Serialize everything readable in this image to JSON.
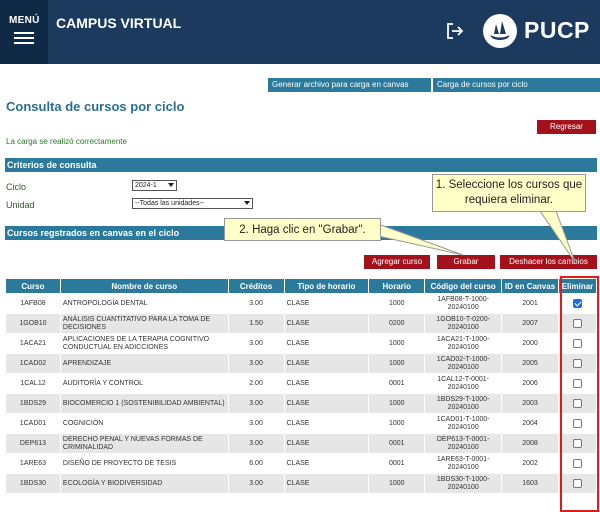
{
  "header": {
    "menu_label": "MENÚ",
    "app_title": "CAMPUS VIRTUAL",
    "brand": "PUCP"
  },
  "toplinks": {
    "generate": "Generar archivo para carga en canvas",
    "load": "Carga de cursos por ciclo"
  },
  "page": {
    "title": "Consulta de cursos por ciclo",
    "back_label": "Regresar",
    "success": "La carga se realizó correctamente"
  },
  "criteria": {
    "section_title": "Criterios de consulta",
    "ciclo_label": "Ciclo",
    "ciclo_value": "2024-1",
    "unidad_label": "Unidad",
    "unidad_value": "--Todas las unidades--"
  },
  "courses": {
    "section_title": "Cursos regstrados en canvas en el ciclo",
    "add_label": "Agregar curso",
    "save_label": "Grabar",
    "undo_label": "Deshacer los cambios",
    "columns": [
      "Curso",
      "Nombre de curso",
      "Créditos",
      "Tipo de horario",
      "Horario",
      "Código del curso",
      "ID en Canvas",
      "Eliminar"
    ],
    "rows": [
      {
        "curso": "1AFB08",
        "nombre": "ANTROPOLOGÍA DENTAL",
        "creditos": "3.00",
        "tipo": "CLASE",
        "horario": "1000",
        "codigo": "1AFB08-T-1000-20240100",
        "id": "2001",
        "eliminar": true
      },
      {
        "curso": "1GOB10",
        "nombre": "ANÁLISIS CUANTITATIVO PARA LA TOMA DE DECISIONES",
        "creditos": "1.50",
        "tipo": "CLASE",
        "horario": "0200",
        "codigo": "1GOB10-T-0200-20240100",
        "id": "2007",
        "eliminar": false
      },
      {
        "curso": "1ACA21",
        "nombre": "APLICACIONES DE LA TERAPIA COGNITIVO CONDUCTUAL EN ADICCIONES",
        "creditos": "3.00",
        "tipo": "CLASE",
        "horario": "1000",
        "codigo": "1ACA21-T-1000-20240100",
        "id": "2000",
        "eliminar": false
      },
      {
        "curso": "1CAD02",
        "nombre": "APRENDIZAJE",
        "creditos": "3.00",
        "tipo": "CLASE",
        "horario": "1000",
        "codigo": "1CAD02-T-1000-20240100",
        "id": "2005",
        "eliminar": false
      },
      {
        "curso": "1CAL12",
        "nombre": "AUDITORÍA Y CONTROL",
        "creditos": "2.00",
        "tipo": "CLASE",
        "horario": "0001",
        "codigo": "1CAL12-T-0001-20240100",
        "id": "2006",
        "eliminar": false
      },
      {
        "curso": "1BDS29",
        "nombre": "BIOCOMERCIO 1 (SOSTENIBILIDAD AMBIENTAL)",
        "creditos": "3.00",
        "tipo": "CLASE",
        "horario": "1000",
        "codigo": "1BDS29-T-1000-20240100",
        "id": "2003",
        "eliminar": false
      },
      {
        "curso": "1CAD01",
        "nombre": "COGNICIÓN",
        "creditos": "3.00",
        "tipo": "CLASE",
        "horario": "1000",
        "codigo": "1CAD01-T-1000-20240100",
        "id": "2004",
        "eliminar": false
      },
      {
        "curso": "DEP613",
        "nombre": "DERECHO PENAL Y NUEVAS FORMAS DE CRIMINALIDAD",
        "creditos": "3.00",
        "tipo": "CLASE",
        "horario": "0001",
        "codigo": "DEP613-T-0001-20240100",
        "id": "2008",
        "eliminar": false
      },
      {
        "curso": "1ARE63",
        "nombre": "DISEÑO DE PROYECTO DE TESIS",
        "creditos": "6.00",
        "tipo": "CLASE",
        "horario": "0001",
        "codigo": "1ARE63-T-0001-20240100",
        "id": "2002",
        "eliminar": false
      },
      {
        "curso": "1BDS30",
        "nombre": "ECOLOGÍA Y BIODIVERSIDAD",
        "creditos": "3.00",
        "tipo": "CLASE",
        "horario": "1000",
        "codigo": "1BDS30-T-1000-20240100",
        "id": "1603",
        "eliminar": false
      }
    ]
  },
  "callouts": {
    "select": "1. Seleccione los cursos que requiera eliminar.",
    "save": "2. Haga clic en \"Grabar\"."
  },
  "colors": {
    "header_bg": "#1b3a5e",
    "accent": "#2b7a9b",
    "button_red": "#a3121a",
    "highlight_frame": "#e01b1b",
    "callout_bg": "#ffffc8"
  }
}
